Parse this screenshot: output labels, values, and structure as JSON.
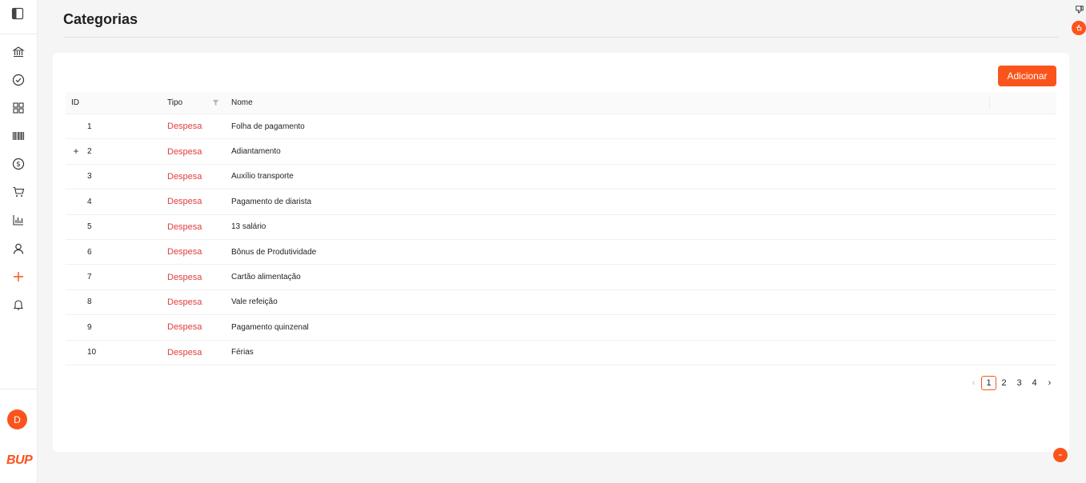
{
  "page": {
    "title": "Categorias"
  },
  "colors": {
    "accent": "#fa541c",
    "expense": "#e23d3d"
  },
  "sidebar": {
    "toggle_icon": "sidebar-toggle-icon",
    "items": [
      {
        "name": "bank",
        "icon": "bank-icon"
      },
      {
        "name": "tasks",
        "icon": "check-circle-icon"
      },
      {
        "name": "dashboard",
        "icon": "grid-icon"
      },
      {
        "name": "barcode",
        "icon": "barcode-icon"
      },
      {
        "name": "finance",
        "icon": "dollar-circle-icon"
      },
      {
        "name": "shop",
        "icon": "cart-icon"
      },
      {
        "name": "reports",
        "icon": "bar-chart-icon"
      },
      {
        "name": "users",
        "icon": "user-icon"
      },
      {
        "name": "add",
        "icon": "plus-icon"
      },
      {
        "name": "notifications",
        "icon": "bell-icon"
      }
    ],
    "avatar_initial": "D",
    "logo_text": "BUP"
  },
  "toolbar": {
    "add_label": "Adicionar"
  },
  "table": {
    "columns": {
      "id": "ID",
      "tipo": "Tipo",
      "nome": "Nome"
    },
    "rows": [
      {
        "id": "1",
        "tipo": "Despesa",
        "nome": "Folha de pagamento",
        "expandable": false
      },
      {
        "id": "2",
        "tipo": "Despesa",
        "nome": "Adiantamento",
        "expandable": true
      },
      {
        "id": "3",
        "tipo": "Despesa",
        "nome": "Auxílio transporte",
        "expandable": false
      },
      {
        "id": "4",
        "tipo": "Despesa",
        "nome": "Pagamento de diarista",
        "expandable": false
      },
      {
        "id": "5",
        "tipo": "Despesa",
        "nome": "13 salário",
        "expandable": false
      },
      {
        "id": "6",
        "tipo": "Despesa",
        "nome": "Bônus de Produtividade",
        "expandable": false
      },
      {
        "id": "7",
        "tipo": "Despesa",
        "nome": "Cartão alimentação",
        "expandable": false
      },
      {
        "id": "8",
        "tipo": "Despesa",
        "nome": "Vale refeição",
        "expandable": false
      },
      {
        "id": "9",
        "tipo": "Despesa",
        "nome": "Pagamento quinzenal",
        "expandable": false
      },
      {
        "id": "10",
        "tipo": "Despesa",
        "nome": "Férias",
        "expandable": false
      }
    ]
  },
  "pagination": {
    "pages": [
      "1",
      "2",
      "3",
      "4"
    ],
    "current": "1"
  }
}
